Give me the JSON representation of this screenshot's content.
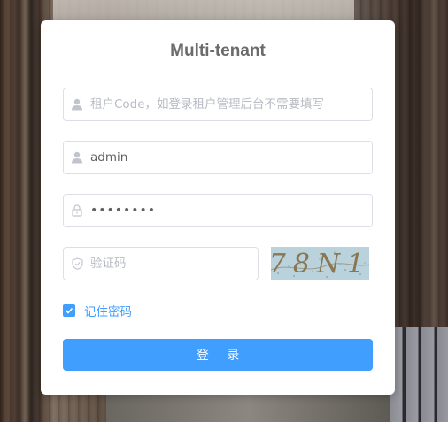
{
  "form": {
    "title": "Multi-tenant",
    "tenant": {
      "placeholder": "租户Code，如登录租户管理后台不需要填写",
      "value": ""
    },
    "username": {
      "placeholder": "",
      "value": "admin"
    },
    "password": {
      "placeholder": "",
      "value": "••••••••"
    },
    "captcha": {
      "placeholder": "验证码",
      "value": "",
      "image_text": "78N1"
    },
    "remember": {
      "label": "记住密码",
      "checked": true
    },
    "login_label": "登 录"
  },
  "icons": {
    "tenant": "user-icon",
    "username": "user-icon",
    "password": "lock-icon",
    "captcha": "shield-icon",
    "remember": "check-icon"
  },
  "colors": {
    "primary": "#409eff",
    "border": "#dcdfe6",
    "icon": "#c0c4cc",
    "title": "#6b6b6b"
  }
}
